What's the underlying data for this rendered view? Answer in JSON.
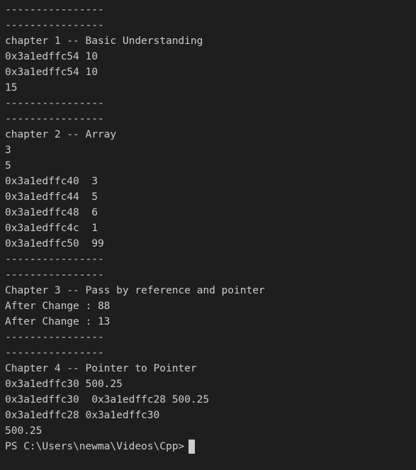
{
  "terminal": {
    "lines": [
      "----------------",
      "----------------",
      "chapter 1 -- Basic Understanding",
      "0x3a1edffc54 10",
      "0x3a1edffc54 10",
      "15",
      "----------------",
      "----------------",
      "chapter 2 -- Array",
      "3",
      "5",
      "0x3a1edffc40  3",
      "0x3a1edffc44  5",
      "0x3a1edffc48  6",
      "0x3a1edffc4c  1",
      "0x3a1edffc50  99",
      "----------------",
      "----------------",
      "Chapter 3 -- Pass by reference and pointer",
      "After Change : 88",
      "After Change : 13",
      "----------------",
      "----------------",
      "Chapter 4 -- Pointer to Pointer",
      "0x3a1edffc30 500.25",
      "0x3a1edffc30  0x3a1edffc28 500.25",
      "0x3a1edffc28 0x3a1edffc30",
      "500.25"
    ],
    "prompt": "PS C:\\Users\\newma\\Videos\\Cpp>"
  }
}
